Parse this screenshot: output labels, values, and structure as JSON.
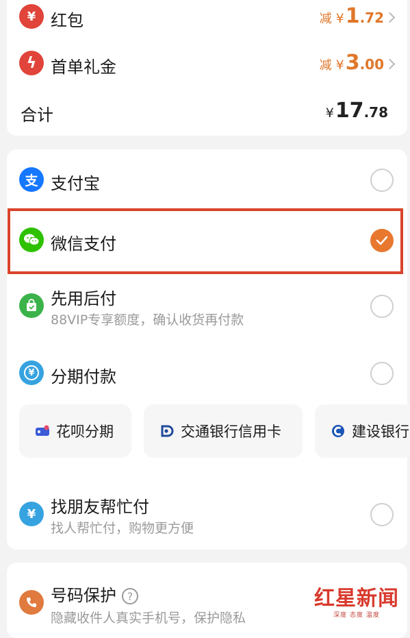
{
  "order_summary": {
    "red_packet": {
      "label": "红包",
      "icon": "red-packet-icon",
      "icon_glyph": "¥",
      "prefix": "减",
      "currency": "¥",
      "int": "1",
      "dec": ".72"
    },
    "first_order_gift": {
      "label": "首单礼金",
      "icon": "lightning-icon",
      "icon_glyph": "ϟ",
      "prefix": "减",
      "currency": "¥",
      "int": "3",
      "dec": ".00"
    },
    "total": {
      "label": "合计",
      "currency": "¥",
      "int": "17",
      "dec": ".78"
    }
  },
  "payment_methods": {
    "alipay": {
      "label": "支付宝",
      "icon": "alipay-icon",
      "icon_glyph": "支",
      "selected": false
    },
    "wechat": {
      "label": "微信支付",
      "icon": "wechat-icon",
      "selected": true
    },
    "pay_later": {
      "label": "先用后付",
      "sub": "88VIP专享额度，确认收货再付款",
      "icon": "bag-icon",
      "selected": false
    },
    "installment": {
      "label": "分期付款",
      "icon": "installment-icon",
      "icon_glyph": "¥",
      "selected": false,
      "options": [
        {
          "label": "花呗分期",
          "icon": "huabei-icon"
        },
        {
          "label": "交通银行信用卡",
          "icon": "bocom-icon"
        },
        {
          "label": "建设银行",
          "icon": "ccb-icon"
        }
      ]
    },
    "friend_pay": {
      "label": "找朋友帮忙付",
      "sub": "找人帮忙付，购物更方便",
      "icon": "friend-pay-icon",
      "icon_glyph": "¥",
      "selected": false
    }
  },
  "privacy": {
    "label": "号码保护",
    "sub": "隐藏收件人真实手机号，保护隐私",
    "icon": "phone-shield-icon",
    "help_glyph": "?"
  },
  "watermark": {
    "main": "红星新闻",
    "sub": "深度 态度 温度"
  },
  "colors": {
    "accent": "#e8782e",
    "highlight": "#d9442b",
    "alipay": "#1677ff",
    "wechat": "#2dc100"
  }
}
